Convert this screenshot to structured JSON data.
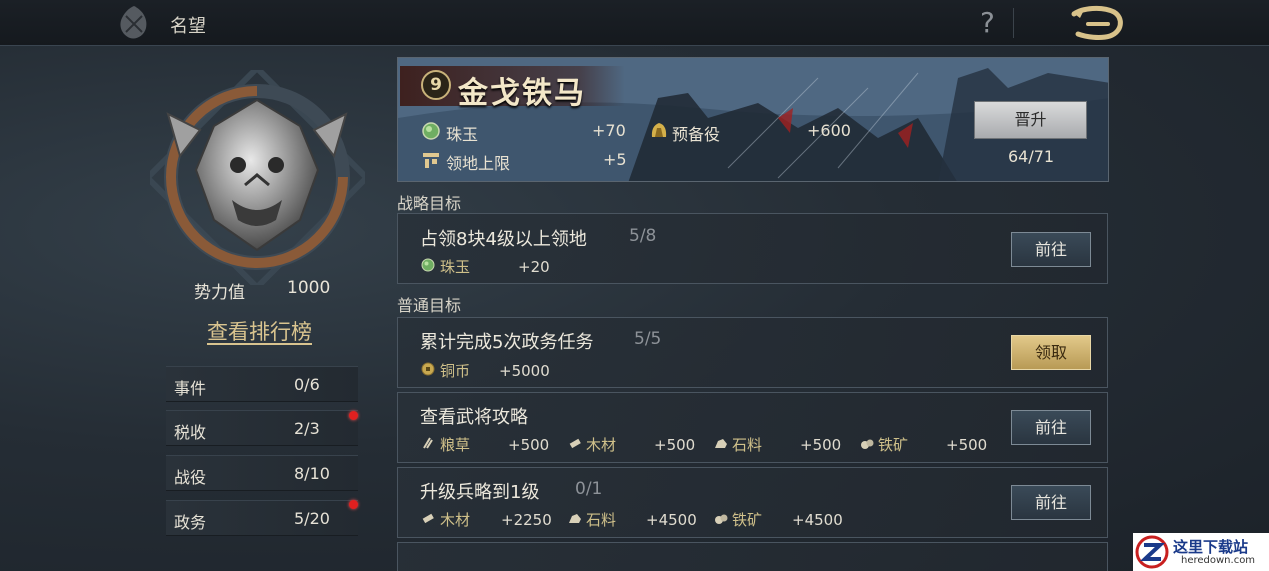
{
  "header": {
    "title": "名望",
    "help": "?"
  },
  "profile": {
    "power_label": "势力值",
    "power_value": "1000",
    "rank_link": "查看排行榜",
    "stats": [
      {
        "label": "事件",
        "value": "0/6",
        "badge": false
      },
      {
        "label": "税收",
        "value": "2/3",
        "badge": true
      },
      {
        "label": "战役",
        "value": "8/10",
        "badge": false
      },
      {
        "label": "政务",
        "value": "5/20",
        "badge": true
      }
    ]
  },
  "rank": {
    "level": "9",
    "title": "金戈铁马",
    "bonuses": [
      {
        "icon": "jade-icon",
        "name": "珠玉",
        "value": "+70"
      },
      {
        "icon": "reserve-troops-icon",
        "name": "预备役",
        "value": "+600"
      },
      {
        "icon": "territory-icon",
        "name": "领地上限",
        "value": "+5"
      }
    ],
    "promote_label": "晋升",
    "progress_text": "64/71"
  },
  "strategic": {
    "title": "战略目标",
    "tasks": [
      {
        "title": "占领8块4级以上领地",
        "progress": "5/8",
        "rewards": [
          {
            "icon": "jade-icon",
            "name": "珠玉",
            "value": "+20"
          }
        ],
        "button": "前往",
        "button_type": "go"
      }
    ]
  },
  "normal": {
    "title": "普通目标",
    "tasks": [
      {
        "title": "累计完成5次政务任务",
        "progress": "5/5",
        "rewards": [
          {
            "icon": "copper-coin-icon",
            "name": "铜币",
            "value": "+5000"
          }
        ],
        "button": "领取",
        "button_type": "claim"
      },
      {
        "title": "查看武将攻略",
        "progress": "",
        "rewards": [
          {
            "icon": "grain-icon",
            "name": "粮草",
            "value": "+500"
          },
          {
            "icon": "wood-icon",
            "name": "木材",
            "value": "+500"
          },
          {
            "icon": "stone-icon",
            "name": "石料",
            "value": "+500"
          },
          {
            "icon": "iron-ore-icon",
            "name": "铁矿",
            "value": "+500"
          }
        ],
        "button": "前往",
        "button_type": "go"
      },
      {
        "title": "升级兵略到1级",
        "progress": "0/1",
        "rewards": [
          {
            "icon": "wood-icon",
            "name": "木材",
            "value": "+2250"
          },
          {
            "icon": "stone-icon",
            "name": "石料",
            "value": "+4500"
          },
          {
            "icon": "iron-ore-icon",
            "name": "铁矿",
            "value": "+4500"
          }
        ],
        "button": "前往",
        "button_type": "go"
      }
    ]
  },
  "watermark": {
    "text": "这里下载站",
    "sub": "heredown.com"
  },
  "colors": {
    "accent_gold": "#cfc08a",
    "claim_button": "#d4b873",
    "alert_red": "#e02020"
  }
}
